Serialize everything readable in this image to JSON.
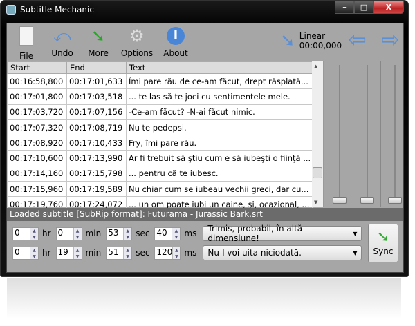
{
  "window": {
    "title": "Subtitle Mechanic",
    "minimize": "–",
    "maximize": "□",
    "close": "X"
  },
  "toolbar": {
    "file": "File",
    "undo": "Undo",
    "more": "More",
    "options": "Options",
    "about": "About",
    "mode": "Linear",
    "offset": "00:00,000"
  },
  "table": {
    "headers": [
      "Start",
      "End",
      "Text"
    ],
    "rows": [
      [
        "00:16:58,800",
        "00:17:01,633",
        "Îmi pare rău de ce-am făcut, drept răsplată..."
      ],
      [
        "00:17:01,800",
        "00:17:03,518",
        "... te las să te joci cu sentimentele mele."
      ],
      [
        "00:17:03,720",
        "00:17:07,156",
        "-Ce-am făcut? -N-ai făcut nimic."
      ],
      [
        "00:17:07,320",
        "00:17:08,719",
        "Nu te pedepsi."
      ],
      [
        "00:17:08,920",
        "00:17:10,433",
        "Fry, îmi pare rău."
      ],
      [
        "00:17:10,600",
        "00:17:13,990",
        "Ar fi trebuit să ştiu cum e să iubeşti o fiinţă ..."
      ],
      [
        "00:17:14,160",
        "00:17:15,798",
        "... pentru că te iubesc."
      ],
      [
        "00:17:15,960",
        "00:17:19,589",
        "Nu chiar cum se iubeau vechii greci, dar cu..."
      ],
      [
        "00:17:19,760",
        "00:17:24,072",
        "... un om poate iubi un caine, şi, ocazional, ..."
      ]
    ]
  },
  "status": "Loaded subtitle [SubRip format]: Futurama - Jurassic Bark.srt",
  "units": {
    "hr": "hr",
    "min": "min",
    "sec": "sec",
    "ms": "ms"
  },
  "sync1": {
    "hr": "0",
    "min": "0",
    "sec": "53",
    "ms": "40",
    "line": "Trimis, probabil, în altă dimensiune!"
  },
  "sync2": {
    "hr": "0",
    "min": "19",
    "sec": "51",
    "ms": "120",
    "line": "Nu-l voi uita niciodată."
  },
  "sync_label": "Sync"
}
